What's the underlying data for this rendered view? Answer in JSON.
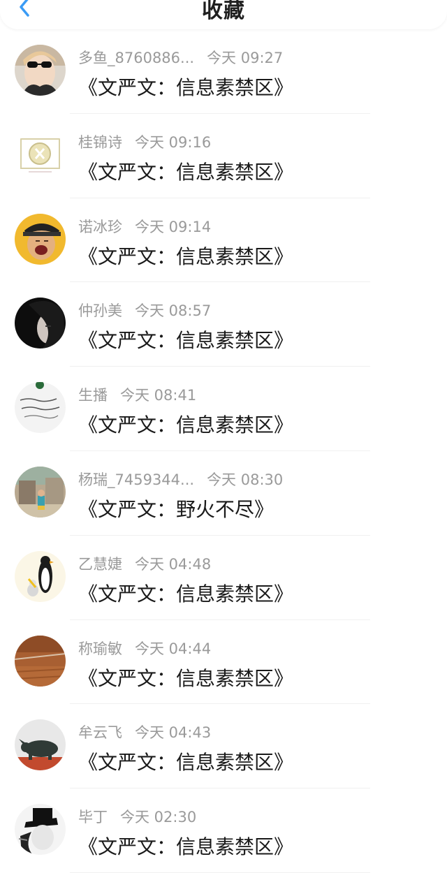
{
  "header": {
    "title": "收藏",
    "back_icon": "chevron-left-icon",
    "accent_color": "#3a9bf5"
  },
  "messages": [
    {
      "name": "多鱼_8760886...",
      "time": "今天 09:27",
      "text": "《文严文：信息素禁区》"
    },
    {
      "name": "桂锦诗",
      "time": "今天 09:16",
      "text": "《文严文：信息素禁区》"
    },
    {
      "name": "诺冰珍",
      "time": "今天 09:14",
      "text": "《文严文：信息素禁区》"
    },
    {
      "name": "仲孙美",
      "time": "今天 08:57",
      "text": "《文严文：信息素禁区》"
    },
    {
      "name": "生播",
      "time": "今天 08:41",
      "text": "《文严文：信息素禁区》"
    },
    {
      "name": "杨瑞_7459344...",
      "time": "今天 08:30",
      "text": "《文严文：野火不尽》"
    },
    {
      "name": "乙慧婕",
      "time": "今天 04:48",
      "text": "《文严文：信息素禁区》"
    },
    {
      "name": "称瑜敏",
      "time": "今天 04:44",
      "text": "《文严文：信息素禁区》"
    },
    {
      "name": "牟云飞",
      "time": "今天 04:43",
      "text": "《文严文：信息素禁区》"
    },
    {
      "name": "毕丁",
      "time": "今天 02:30",
      "text": "《文严文：信息素禁区》"
    }
  ]
}
